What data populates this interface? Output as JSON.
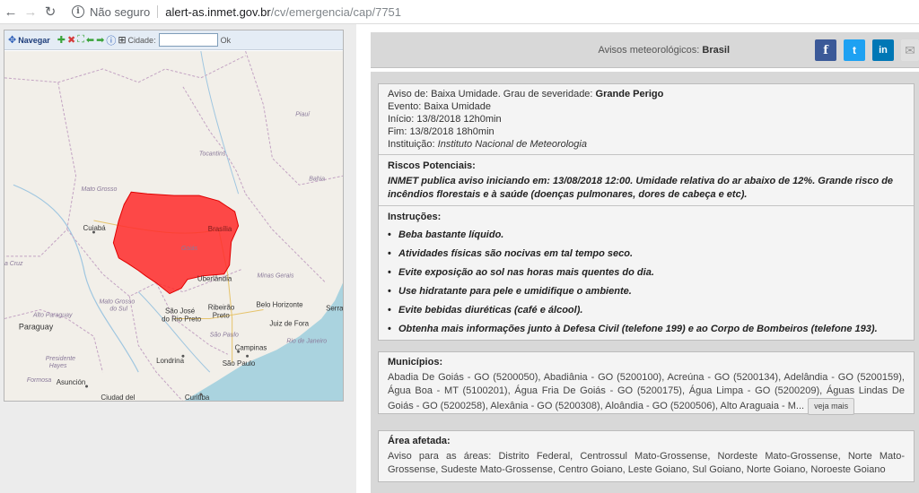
{
  "browser": {
    "security_label": "Não seguro",
    "url_host": "alert-as.inmet.gov.br",
    "url_path": "/cv/emergencia/cap/7751"
  },
  "map": {
    "toolbar": {
      "navigate_label": "Navegar",
      "city_label": "Cidade:",
      "ok_label": "Ok"
    },
    "labels": {
      "piaui": "Piauí",
      "tocantins": "Tocantins",
      "bahia": "Bahia",
      "mato_grosso": "Mato Grosso",
      "cuiaba": "Cuiabá",
      "brasilia": "Brasília",
      "goias": "Goiás",
      "cruz": "a Cruz",
      "minas_gerais": "Minas Gerais",
      "uberlandia": "Uberlândia",
      "ms_line1": "Mato Grosso",
      "ms_line2": "do Sul",
      "alto_paraguay": "Alto Paraguay",
      "sjrp_line1": "São José",
      "sjrp_line2": "do Rio Preto",
      "ribeirao_line1": "Ribeirão",
      "ribeirao_line2": "Preto",
      "belo_horizonte": "Belo Horizonte",
      "serra": "Serra",
      "juiz_de_fora": "Juiz de Fora",
      "paraguay": "Paraguay",
      "sao_paulo_state": "São Paulo",
      "rio_de_janeiro": "Rio de Janeiro",
      "campinas": "Campinas",
      "presidente_line1": "Presidente",
      "presidente_line2": "Hayes",
      "londrina": "Londrina",
      "sao_paulo": "São Paulo",
      "formosa": "Formosa",
      "asuncion": "Asunción",
      "ciudad_del": "Ciudad del",
      "curitiba": "Curitiba"
    },
    "alert_color": "#ff2a2a"
  },
  "header": {
    "prefix": "Avisos meteorológicos:",
    "region": "Brasil"
  },
  "social": {
    "facebook": "f",
    "twitter": "t",
    "linkedin": "in",
    "email": "✉"
  },
  "alert": {
    "aviso_prefix": "Aviso de: Baixa Umidade. Grau de severidade:",
    "severity": "Grande Perigo",
    "evento": "Evento: Baixa Umidade",
    "inicio": "Início: 13/8/2018 12h0min",
    "fim": "Fim: 13/8/2018 18h0min",
    "instituicao_prefix": "Instituição:",
    "instituicao": "Instituto Nacional de Meteorologia",
    "riscos_title": "Riscos Potenciais:",
    "riscos_text": "INMET publica aviso iniciando em: 13/08/2018 12:00. Umidade relativa do ar abaixo de 12%. Grande risco de incêndios florestais e à saúde (doenças pulmonares, dores de cabeça e etc).",
    "instrucoes_title": "Instruções:",
    "instrucoes": [
      "Beba bastante líquido.",
      "Atividades físicas são nocivas em tal tempo seco.",
      "Evite exposição ao sol nas horas mais quentes do dia.",
      "Use hidratante para pele e umidifique o ambiente.",
      "Evite bebidas diuréticas (café e álcool).",
      "Obtenha mais informações junto à Defesa Civil (telefone 199) e ao Corpo de Bombeiros (telefone 193)."
    ]
  },
  "municipios": {
    "title": "Municípios:",
    "text": "Abadia De Goiás - GO (5200050), Abadiânia - GO (5200100), Acreúna - GO (5200134), Adelândia - GO (5200159), Água Boa - MT (5100201), Água Fria De Goiás - GO (5200175), Água Limpa - GO (5200209), Águas Lindas De Goiás - GO (5200258), Alexânia - GO (5200308), Aloândia - GO (5200506), Alto Araguaia - M...",
    "more_label": "veja mais"
  },
  "area": {
    "title": "Área afetada:",
    "text": "Aviso para as áreas: Distrito Federal, Centrossul Mato-Grossense, Nordeste Mato-Grossense, Norte Mato-Grossense, Sudeste Mato-Grossense, Centro Goiano, Leste Goiano, Sul Goiano, Norte Goiano, Noroeste Goiano"
  }
}
